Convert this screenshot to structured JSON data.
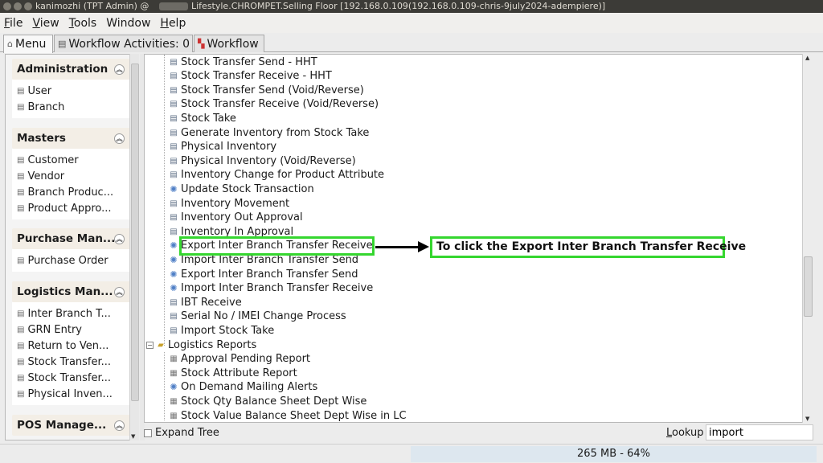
{
  "titlebar": {
    "app": "kanimozhi (TPT Admin) @",
    "window": "Lifestyle.CHROMPET.Selling Floor [192.168.0.109(192.168.0.109-chris-9july2024-adempiere)]"
  },
  "menubar": {
    "items": [
      {
        "first": "F",
        "rest": "ile"
      },
      {
        "first": "V",
        "rest": "iew"
      },
      {
        "first": "T",
        "rest": "ools"
      },
      {
        "first": "",
        "rest": "Window"
      },
      {
        "first": "H",
        "rest": "elp"
      }
    ]
  },
  "tabs": {
    "menu": "Menu",
    "activities": "Workflow Activities: 0",
    "workflow": "Workflow"
  },
  "left_panel": {
    "groups": [
      {
        "title": "Administration",
        "items": [
          "User",
          "Branch"
        ]
      },
      {
        "title": "Masters",
        "items": [
          "Customer",
          "Vendor",
          "Branch Produc...",
          "Product Appro..."
        ]
      },
      {
        "title": "Purchase Man...",
        "items": [
          "Purchase Order"
        ]
      },
      {
        "title": "Logistics Man...",
        "items": [
          "Inter Branch T...",
          "GRN Entry",
          "Return to Ven...",
          "Stock Transfer...",
          "Stock Transfer...",
          "Physical Inven..."
        ]
      },
      {
        "title": "POS Manage...",
        "items": []
      }
    ]
  },
  "tree": {
    "nodes": [
      {
        "label": "Stock Transfer Send - HHT",
        "icon": "window-icon"
      },
      {
        "label": "Stock Transfer Receive - HHT",
        "icon": "window-icon"
      },
      {
        "label": "Stock Transfer Send (Void/Reverse)",
        "icon": "window-icon"
      },
      {
        "label": "Stock Transfer Receive (Void/Reverse)",
        "icon": "window-icon"
      },
      {
        "label": "Stock Take",
        "icon": "window-icon"
      },
      {
        "label": "Generate Inventory from Stock Take",
        "icon": "window-icon"
      },
      {
        "label": "Physical Inventory",
        "icon": "window-icon"
      },
      {
        "label": "Physical Inventory (Void/Reverse)",
        "icon": "window-icon"
      },
      {
        "label": "Inventory Change for Product Attribute",
        "icon": "window-icon"
      },
      {
        "label": "Update Stock Transaction",
        "icon": "process-icon"
      },
      {
        "label": "Inventory Movement",
        "icon": "window-icon"
      },
      {
        "label": "Inventory Out Approval",
        "icon": "window-icon"
      },
      {
        "label": "Inventory In Approval",
        "icon": "window-icon"
      },
      {
        "label": "Export Inter Branch Transfer Receive",
        "icon": "process-icon"
      },
      {
        "label": "Import Inter Branch Transfer Send",
        "icon": "process-icon"
      },
      {
        "label": "Export Inter Branch Transfer Send",
        "icon": "process-icon"
      },
      {
        "label": "Import Inter Branch Transfer Receive",
        "icon": "process-icon"
      },
      {
        "label": "IBT Receive",
        "icon": "window-icon"
      },
      {
        "label": "Serial No / IMEI Change Process",
        "icon": "window-icon"
      },
      {
        "label": "Import Stock Take",
        "icon": "window-icon"
      }
    ],
    "folder": {
      "label": "Logistics Reports",
      "toggle": "−"
    },
    "reports": [
      {
        "label": "Approval Pending Report",
        "icon": "report-icon"
      },
      {
        "label": "Stock Attribute Report",
        "icon": "report-icon"
      },
      {
        "label": "On Demand Mailing Alerts",
        "icon": "process-icon"
      },
      {
        "label": "Stock Qty Balance Sheet Dept Wise",
        "icon": "report-icon"
      },
      {
        "label": "Stock Value Balance Sheet Dept Wise in LC",
        "icon": "report-icon"
      }
    ]
  },
  "annotation": {
    "callout": "To click the Export Inter Branch Transfer Receive",
    "highlight_color": "#35d62f"
  },
  "bottom": {
    "expand_tree": "Expand Tree",
    "lookup_first": "L",
    "lookup_rest": "ookup",
    "lookup_value": "import"
  },
  "status": {
    "memory": "265 MB - 64%"
  }
}
